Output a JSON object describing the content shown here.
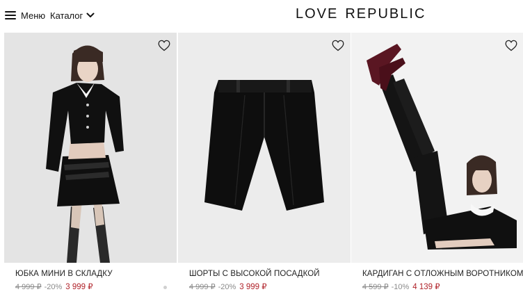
{
  "header": {
    "menu_label": "Меню",
    "catalog_label": "Каталог",
    "logo_word1": "LOVE",
    "logo_word2": "REPUBLIC"
  },
  "products": [
    {
      "title": "ЮБКА МИНИ В СКЛАДКУ",
      "old_price": "4 999 ₽",
      "discount": "-20%",
      "price": "3 999 ₽"
    },
    {
      "title": "ШОРТЫ С ВЫСОКОЙ ПОСАДКОЙ",
      "old_price": "4 999 ₽",
      "discount": "-20%",
      "price": "3 999 ₽"
    },
    {
      "title": "КАРДИГАН С ОТЛОЖНЫМ ВОРОТНИКОМ",
      "old_price": "4 599 ₽",
      "discount": "-10%",
      "price": "4 139 ₽"
    }
  ],
  "colors": {
    "sale_price": "#b0232a",
    "old_price": "#8a8a8a",
    "text": "#111111"
  },
  "icons": [
    "burger-icon",
    "chevron-down-icon",
    "heart-icon"
  ]
}
